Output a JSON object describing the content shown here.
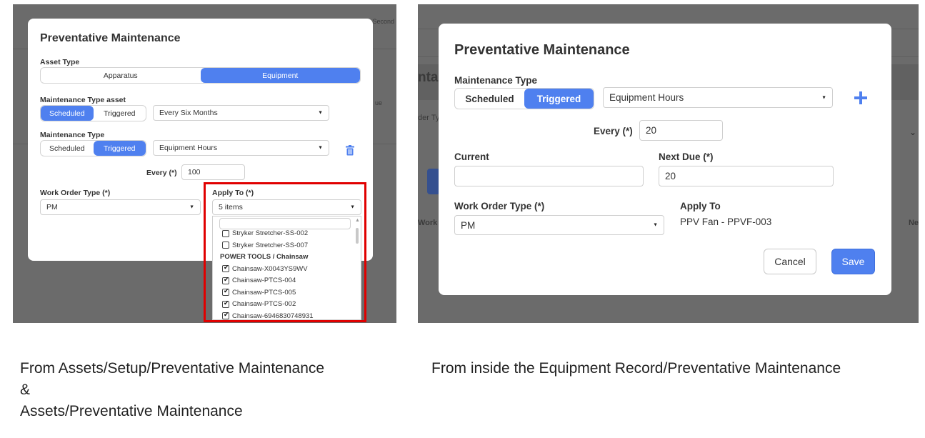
{
  "left_panel": {
    "background_text": {
      "second": "Second",
      "due": "ue"
    },
    "modal": {
      "title": "Preventative Maintenance",
      "asset_type": {
        "label": "Asset Type",
        "options": [
          "Apparatus",
          "Equipment"
        ],
        "selected": "Equipment"
      },
      "maintenance_type_asset": {
        "label": "Maintenance Type asset",
        "options": [
          "Scheduled",
          "Triggered"
        ],
        "selected": "Scheduled",
        "interval": "Every Six Months"
      },
      "maintenance_type": {
        "label": "Maintenance Type",
        "options": [
          "Scheduled",
          "Triggered"
        ],
        "selected": "Triggered",
        "trigger": "Equipment Hours"
      },
      "every": {
        "label": "Every (*)",
        "value": "100"
      },
      "work_order_type": {
        "label": "Work Order Type (*)",
        "value": "PM"
      },
      "apply_to": {
        "label": "Apply To (*)",
        "value": "5 items",
        "search_placeholder": "",
        "items": [
          {
            "type": "option",
            "text": "Stryker Stretcher-SS-002",
            "checked": false
          },
          {
            "type": "option",
            "text": "Stryker Stretcher-SS-007",
            "checked": false
          },
          {
            "type": "group",
            "text": "POWER TOOLS / Chainsaw"
          },
          {
            "type": "option",
            "text": "Chainsaw-X0043YS9WV",
            "checked": true
          },
          {
            "type": "option",
            "text": "Chainsaw-PTCS-004",
            "checked": true
          },
          {
            "type": "option",
            "text": "Chainsaw-PTCS-005",
            "checked": true
          },
          {
            "type": "option",
            "text": "Chainsaw-PTCS-002",
            "checked": true
          },
          {
            "type": "option",
            "text": "Chainsaw-6946830748931",
            "checked": true
          }
        ]
      }
    },
    "highlight_color": "#e00000"
  },
  "right_panel": {
    "background_text": {
      "nta": "nta",
      "order_ty": "der Ty",
      "work": "Work",
      "ne": "Ne"
    },
    "modal": {
      "title": "Preventative Maintenance",
      "maintenance_type": {
        "label": "Maintenance Type",
        "options": [
          "Scheduled",
          "Triggered"
        ],
        "selected": "Triggered",
        "trigger": "Equipment Hours"
      },
      "every": {
        "label": "Every (*)",
        "value": "20"
      },
      "current": {
        "label": "Current",
        "value": ""
      },
      "next_due": {
        "label": "Next Due (*)",
        "value": "20"
      },
      "work_order_type": {
        "label": "Work Order Type (*)",
        "value": "PM"
      },
      "apply_to": {
        "label": "Apply To",
        "value": "PPV Fan - PPVF-003"
      },
      "cancel_label": "Cancel",
      "save_label": "Save"
    }
  },
  "captions": {
    "left_line1": "From Assets/Setup/Preventative Maintenance",
    "left_line2": "&",
    "left_line3": "Assets/Preventative Maintenance",
    "right": "From inside the Equipment Record/Preventative Maintenance"
  },
  "colors": {
    "accent": "#4f80ef",
    "overlay": "#6b6b6b",
    "highlight": "#e00000"
  }
}
